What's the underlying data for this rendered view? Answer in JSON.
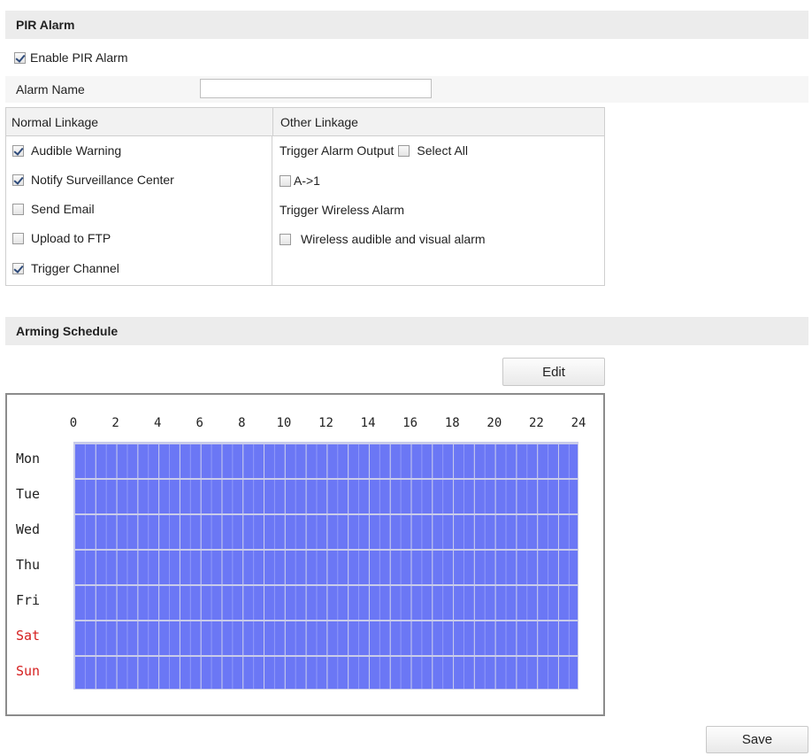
{
  "pir_alarm": {
    "title": "PIR Alarm",
    "enable_label": "Enable PIR Alarm",
    "enable_checked": true,
    "alarm_name_label": "Alarm Name",
    "alarm_name_value": ""
  },
  "linkage": {
    "normal_header": "Normal Linkage",
    "other_header": "Other Linkage",
    "normal_items": [
      {
        "label": "Audible Warning",
        "checked": true
      },
      {
        "label": "Notify Surveillance Center",
        "checked": true
      },
      {
        "label": "Send Email",
        "checked": false
      },
      {
        "label": "Upload to FTP",
        "checked": false
      },
      {
        "label": "Trigger Channel",
        "checked": true
      }
    ],
    "trigger_alarm_output_label": "Trigger Alarm Output",
    "select_all_label": "Select All",
    "select_all_checked": false,
    "output_a1_label": "A->1",
    "output_a1_checked": false,
    "trigger_wireless_label": "Trigger Wireless Alarm",
    "wireless_label": "Wireless audible and visual alarm",
    "wireless_checked": false
  },
  "schedule": {
    "title": "Arming Schedule",
    "edit_label": "Edit",
    "hours": [
      "0",
      "2",
      "4",
      "6",
      "8",
      "10",
      "12",
      "14",
      "16",
      "18",
      "20",
      "22",
      "24"
    ],
    "days": [
      "Mon",
      "Tue",
      "Wed",
      "Thu",
      "Fri",
      "Sat",
      "Sun"
    ],
    "weekend_days": [
      "Sat",
      "Sun"
    ],
    "armed_fraction_per_day": [
      1,
      1,
      1,
      1,
      1,
      1,
      1
    ],
    "armed_color": "#6b77f5",
    "weekend_color": "#d52020"
  },
  "save_label": "Save"
}
